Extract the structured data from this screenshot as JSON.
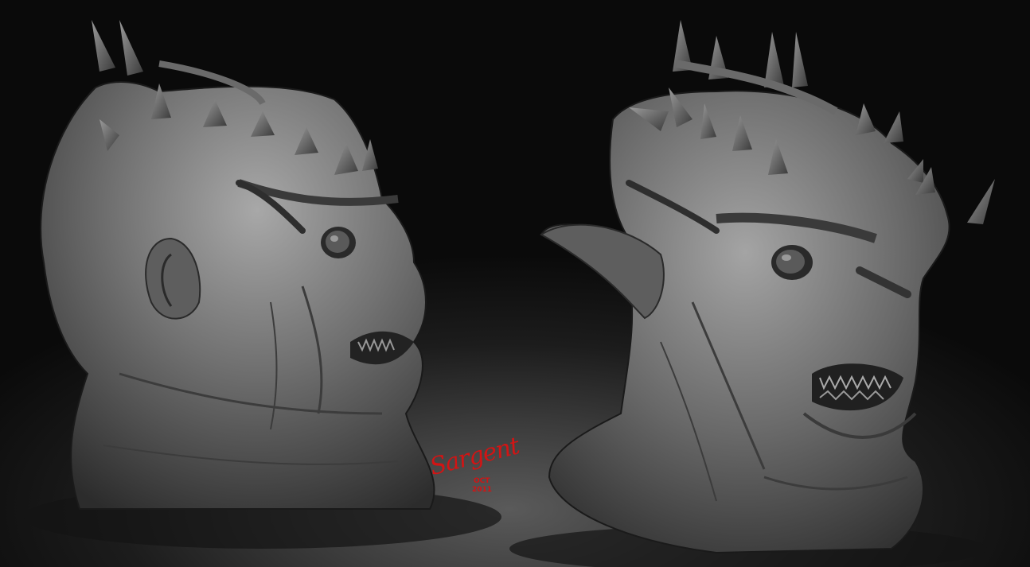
{
  "image": {
    "subject": "creature-sculpt-renders",
    "colors": {
      "background_dark": "#0a0a0a",
      "floor_light": "#5a5a5a",
      "clay": "#7a7a7a",
      "signature": "#d21414"
    }
  },
  "signature": {
    "name": "Sargent",
    "month": "OCT",
    "year": "2011"
  }
}
